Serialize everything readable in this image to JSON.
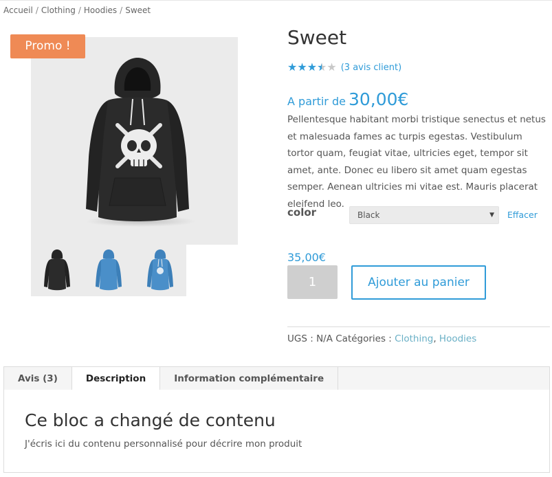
{
  "breadcrumb": {
    "items": [
      "Accueil",
      "Clothing",
      "Hoodies",
      "Sweet"
    ],
    "separator": "/"
  },
  "badge": {
    "label": "Promo !"
  },
  "product": {
    "title": "Sweet",
    "rating": {
      "value": 3.5,
      "max": 5,
      "reviews_label": "(3 avis client)"
    },
    "price_from": {
      "prefix": "A partir de",
      "amount": "30,00€"
    },
    "description": "Pellentesque habitant morbi tristique senectus et netus et malesuada fames ac turpis egestas. Vestibulum tortor quam, feugiat vitae, ultricies eget, tempor sit amet, ante. Donec eu libero sit amet quam egestas semper. Aenean ultricies mi vitae est. Mauris placerat eleifend leo.",
    "variation": {
      "label": "color",
      "selected": "Black",
      "clear_label": "Effacer"
    },
    "variation_price": "35,00€",
    "quantity": "1",
    "add_to_cart_label": "Ajouter au panier",
    "meta": {
      "sku_label": "UGS :",
      "sku_value": "N/A",
      "categories_label": "Catégories :",
      "categories": [
        "Clothing",
        "Hoodies"
      ]
    }
  },
  "gallery": {
    "thumbnails": [
      "black hoodie",
      "blue hoodie",
      "blue hoodie with print"
    ]
  },
  "tabs": {
    "items": [
      "Avis (3)",
      "Description",
      "Information complémentaire"
    ],
    "active": "Description"
  },
  "panel": {
    "title": "Ce bloc a changé de contenu",
    "text": "J'écris ici du contenu personnalisé pour décrire mon produit"
  },
  "colors": {
    "accent": "#2f9bd8",
    "promo": "#ef8a55",
    "link_secondary": "#6ab0c6",
    "hoodie_black": "#2b2b2b",
    "hoodie_blue": "#4a8fc9"
  }
}
